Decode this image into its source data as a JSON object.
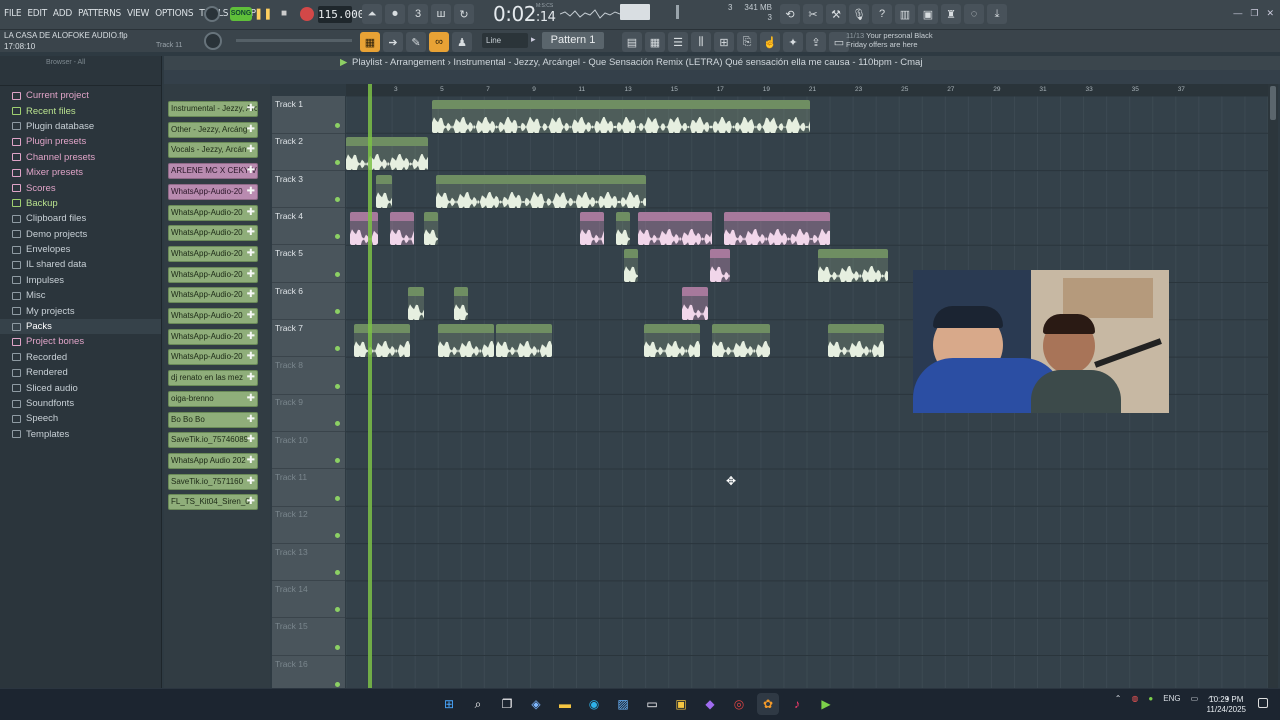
{
  "menu": [
    "FILE",
    "EDIT",
    "ADD",
    "PATTERNS",
    "VIEW",
    "OPTIONS",
    "TOOLS",
    "HELP"
  ],
  "transport": {
    "mode": "SONG",
    "bpm": "115.000",
    "time_main": "0:02",
    "time_sub": "14",
    "time_unit": "M:S:CS"
  },
  "cpu": {
    "memory": "341 MB",
    "polyphony": "3",
    "voices": "3"
  },
  "project": {
    "name": "LA CASA DE ALOFOKE AUDIO.flp",
    "time": "17:08:10",
    "hint": "Track 11"
  },
  "toolbar2": {
    "snap": "Line",
    "pattern": "Pattern 1"
  },
  "promo": {
    "count": "11/13",
    "text1": "Your personal Black",
    "text2": "Friday offers are here"
  },
  "browser": {
    "title": "Browser - All",
    "items": [
      {
        "label": "Current project",
        "style": "pink"
      },
      {
        "label": "Recent files",
        "style": "green"
      },
      {
        "label": "Plugin database",
        "style": "normal"
      },
      {
        "label": "Plugin presets",
        "style": "pink"
      },
      {
        "label": "Channel presets",
        "style": "pink"
      },
      {
        "label": "Mixer presets",
        "style": "pink"
      },
      {
        "label": "Scores",
        "style": "pink"
      },
      {
        "label": "Backup",
        "style": "green"
      },
      {
        "label": "Clipboard files",
        "style": "normal"
      },
      {
        "label": "Demo projects",
        "style": "normal"
      },
      {
        "label": "Envelopes",
        "style": "normal"
      },
      {
        "label": "IL shared data",
        "style": "normal"
      },
      {
        "label": "Impulses",
        "style": "normal"
      },
      {
        "label": "Misc",
        "style": "normal"
      },
      {
        "label": "My projects",
        "style": "normal"
      },
      {
        "label": "Packs",
        "style": "active"
      },
      {
        "label": "Project bones",
        "style": "pink"
      },
      {
        "label": "Recorded",
        "style": "normal"
      },
      {
        "label": "Rendered",
        "style": "normal"
      },
      {
        "label": "Sliced audio",
        "style": "normal"
      },
      {
        "label": "Soundfonts",
        "style": "normal"
      },
      {
        "label": "Speech",
        "style": "normal"
      },
      {
        "label": "Templates",
        "style": "normal"
      }
    ]
  },
  "channels": [
    {
      "label": "Instrumental - Jezzy, Arcáng",
      "color": "green"
    },
    {
      "label": "Other - Jezzy, Arcáng",
      "color": "green"
    },
    {
      "label": "Vocals - Jezzy, Arcán",
      "color": "green"
    },
    {
      "label": "ARLENE MC X CEKY VI",
      "color": "pink"
    },
    {
      "label": "WhatsApp-Audio-20",
      "color": "pink"
    },
    {
      "label": "WhatsApp-Audio-20",
      "color": "green"
    },
    {
      "label": "WhatsApp-Audio-20",
      "color": "green"
    },
    {
      "label": "WhatsApp-Audio-20",
      "color": "green"
    },
    {
      "label": "WhatsApp-Audio-20",
      "color": "green"
    },
    {
      "label": "WhatsApp-Audio-20",
      "color": "green"
    },
    {
      "label": "WhatsApp-Audio-20",
      "color": "green"
    },
    {
      "label": "WhatsApp-Audio-20",
      "color": "green"
    },
    {
      "label": "WhatsApp-Audio-20",
      "color": "green"
    },
    {
      "label": "dj renato en las mez",
      "color": "green"
    },
    {
      "label": "oiga-brenno",
      "color": "green"
    },
    {
      "label": "Bo Bo Bo",
      "color": "green"
    },
    {
      "label": "SaveTik.io_75746089",
      "color": "green"
    },
    {
      "label": "WhatsApp Audio 202",
      "color": "green"
    },
    {
      "label": "SaveTik.io_7571160",
      "color": "green"
    },
    {
      "label": "FL_TS_Kit04_Siren_0",
      "color": "green"
    }
  ],
  "playlist": {
    "title": "Playlist - Arrangement",
    "breadcrumb": "Instrumental - Jezzy, Arcángel - Que Sensación Remix (LETRA) Qué sensación ella me causa - 110bpm - Cmaj",
    "ruler_marks": [
      "3",
      "5",
      "7",
      "9",
      "11",
      "13",
      "15",
      "17",
      "19",
      "21",
      "23",
      "25",
      "27",
      "29",
      "31",
      "33",
      "35",
      "37"
    ],
    "tracks": [
      "Track 1",
      "Track 2",
      "Track 3",
      "Track 4",
      "Track 5",
      "Track 6",
      "Track 7",
      "Track 8",
      "Track 9",
      "Track 10",
      "Track 11",
      "Track 12",
      "Track 13",
      "Track 14",
      "Track 15",
      "Track 16"
    ],
    "clips": [
      {
        "track": 0,
        "label": "Instrumental - Jezzy, Arcángel - Que Sensaci.. Qué sensación ella me causa - 110bpm - Cmaj",
        "color": "g"
      },
      {
        "track": 1,
        "label": "Instrument..pm - Cmaj",
        "color": "g"
      },
      {
        "track": 2,
        "label": "",
        "color": "g"
      },
      {
        "track": 2,
        "label": "Vocals - Jezzy, Arcángel - Que S..n ella me causa - 110bpm - Cmaj",
        "color": "g"
      },
      {
        "track": 3,
        "label": "W..",
        "color": "p"
      },
      {
        "track": 3,
        "label": "",
        "color": "p"
      },
      {
        "track": 3,
        "label": "",
        "color": "g"
      },
      {
        "track": 3,
        "label": "",
        "color": "p"
      },
      {
        "track": 3,
        "label": "",
        "color": "g"
      },
      {
        "track": 3,
        "label": "ARLENE MC..OFOKE 2",
        "color": "p"
      },
      {
        "track": 3,
        "label": "ARLENE MC X CE..DE ALOFOKE 2",
        "color": "p"
      },
      {
        "track": 4,
        "label": "",
        "color": "g"
      },
      {
        "track": 4,
        "label": "",
        "color": "p"
      },
      {
        "track": 4,
        "label": "WhatsAp..2.55 PM",
        "color": "g"
      },
      {
        "track": 5,
        "label": "",
        "color": "g"
      },
      {
        "track": 5,
        "label": "",
        "color": "g"
      },
      {
        "track": 5,
        "label": "Sa..",
        "color": "p"
      },
      {
        "track": 6,
        "label": "FL_TS..._Shot",
        "color": "g"
      },
      {
        "track": 6,
        "label": "FL_TS_..Shot",
        "color": "g"
      },
      {
        "track": 6,
        "label": "FL_TS_..Shot",
        "color": "g"
      },
      {
        "track": 6,
        "label": "FL_TS_..Shot",
        "color": "g"
      },
      {
        "track": 6,
        "label": "FL_TS_..e_Shot",
        "color": "g"
      },
      {
        "track": 6,
        "label": "FL_TS_..Shot",
        "color": "g"
      }
    ]
  },
  "taskbar": {
    "lang": "ENG",
    "time": "10:29 PM",
    "date": "11/24/2025"
  }
}
